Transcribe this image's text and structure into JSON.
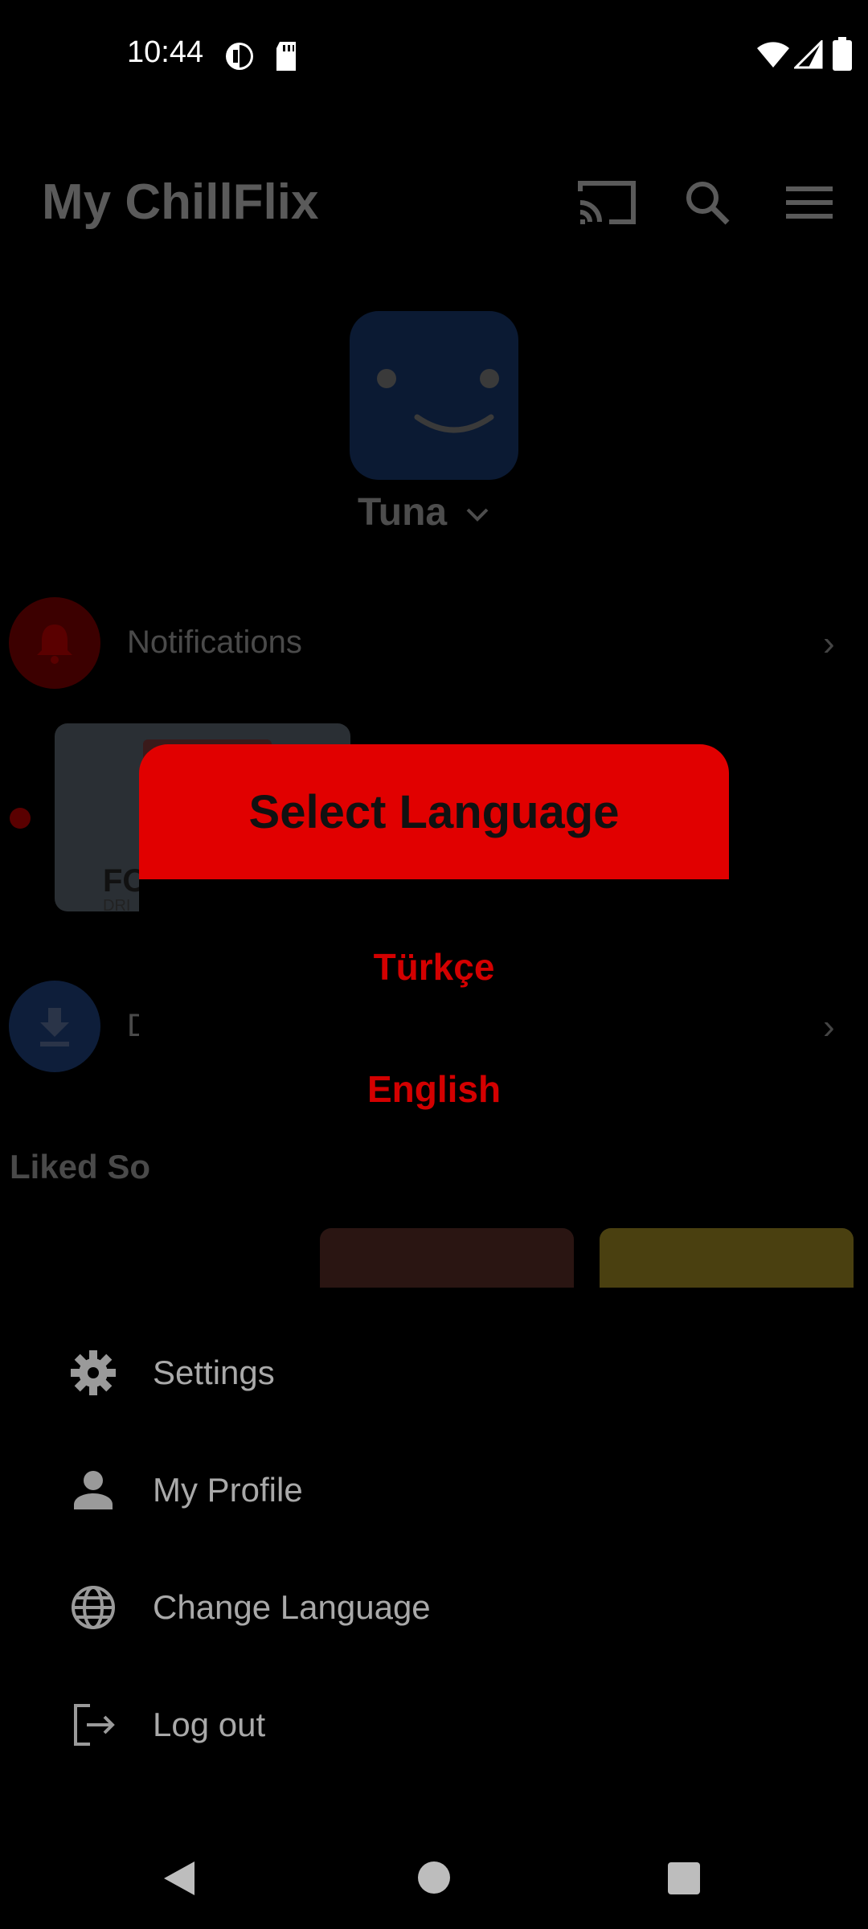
{
  "status_bar": {
    "time": "10:44"
  },
  "header": {
    "title": "My ChillFlix",
    "icons": [
      "cast-icon",
      "search-icon",
      "menu-icon"
    ]
  },
  "profile": {
    "name": "Tuna"
  },
  "rows": {
    "notifications_label": "Notifications",
    "downloads_label_partial": "D"
  },
  "thumbnail": {
    "text": "FO",
    "subtext": "DRI"
  },
  "liked_section": {
    "title_partial": "Liked So"
  },
  "dialog": {
    "title": "Select Language",
    "options": [
      "Türkçe",
      "English"
    ]
  },
  "menu": {
    "items": [
      {
        "label": "Settings",
        "icon": "gear-icon"
      },
      {
        "label": "My Profile",
        "icon": "person-icon"
      },
      {
        "label": "Change Language",
        "icon": "globe-icon"
      },
      {
        "label": "Log out",
        "icon": "logout-icon"
      }
    ]
  },
  "colors": {
    "accent": "#e10000",
    "option_text": "#d30000",
    "background": "#000000"
  }
}
